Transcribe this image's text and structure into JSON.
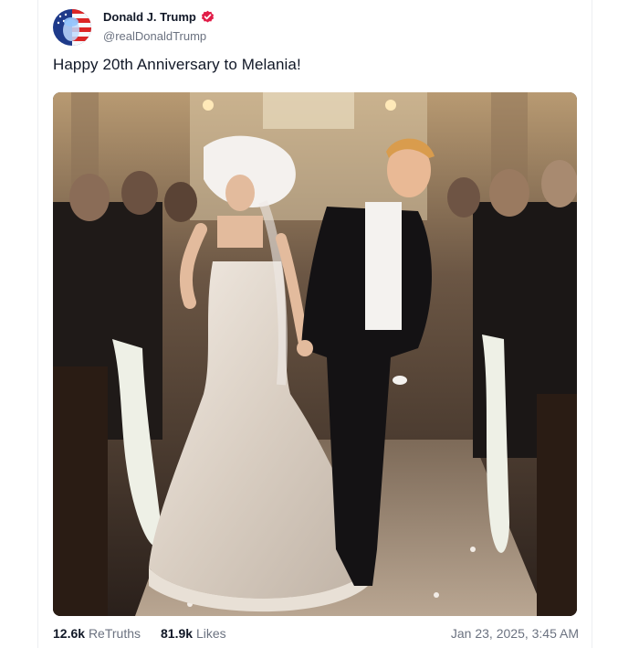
{
  "post": {
    "display_name": "Donald J. Trump",
    "handle": "@realDonaldTrump",
    "text": "Happy 20th Anniversary to Melania!",
    "verified_icon": "verified-badge-icon",
    "verified_color": "#e11d48"
  },
  "media": {
    "type": "photo"
  },
  "stats": {
    "retruths_count": "12.6k",
    "retruths_label": "ReTruths",
    "likes_count": "81.9k",
    "likes_label": "Likes",
    "timestamp": "Jan 23, 2025, 3:45 AM"
  }
}
